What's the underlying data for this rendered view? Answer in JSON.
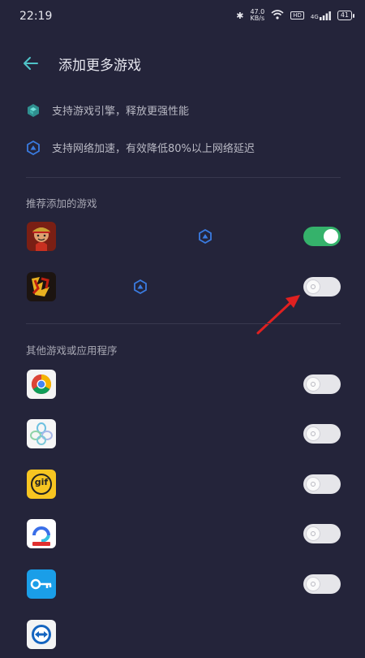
{
  "status_bar": {
    "time": "22:19",
    "net_speed_value": "47.0",
    "net_speed_unit": "KB/s",
    "hd_badge": "HD",
    "signal_label": "4G",
    "battery": "41"
  },
  "header": {
    "title": "添加更多游戏"
  },
  "features": [
    {
      "icon": "game-engine-icon",
      "text": "支持游戏引擎，释放更强性能"
    },
    {
      "icon": "network-boost-icon",
      "text": "支持网络加速，有效降低80%以上网络延迟"
    }
  ],
  "recommended": {
    "heading": "推荐添加的游戏",
    "items": [
      {
        "icon": "one-piece-game-icon",
        "boost_icon": true,
        "enabled": true
      },
      {
        "icon": "three-kingdoms-game-icon",
        "boost_icon": true,
        "enabled": false
      }
    ]
  },
  "others": {
    "heading": "其他游戏或应用程序",
    "items": [
      {
        "icon": "chrome-icon",
        "enabled": false
      },
      {
        "icon": "flower-app-icon",
        "enabled": false
      },
      {
        "icon": "gif-app-icon",
        "text": "gif",
        "enabled": false
      },
      {
        "icon": "baidu-netdisk-icon",
        "enabled": false
      },
      {
        "icon": "key-app-icon",
        "enabled": false
      },
      {
        "icon": "teamviewer-icon",
        "enabled": false
      }
    ]
  },
  "colors": {
    "background": "#24243a",
    "toggle_on": "#35b26b",
    "accent_teal": "#4fc3c8",
    "boost_blue": "#3a7be0",
    "annotation_arrow": "#e02020"
  }
}
